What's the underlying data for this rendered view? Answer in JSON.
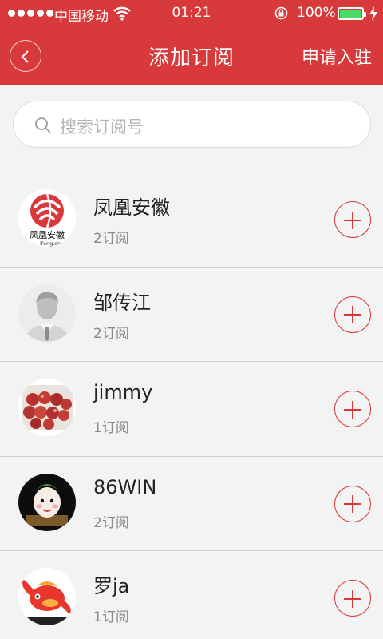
{
  "status_bar": {
    "carrier": "中国移动",
    "time": "01:21",
    "battery": "100%"
  },
  "nav": {
    "title": "添加订阅",
    "apply_label": "申请入驻"
  },
  "search": {
    "placeholder": "搜索订阅号"
  },
  "subscriptions": [
    {
      "name": "凤凰安徽",
      "count": "2订阅",
      "avatar_text": "凤凰安徽",
      "avatar_subtext": "ifeng.cn"
    },
    {
      "name": "邹传江",
      "count": "2订阅"
    },
    {
      "name": "jimmy",
      "count": "1订阅"
    },
    {
      "name": "86WIN",
      "count": "2订阅"
    },
    {
      "name": "罗ja",
      "count": "1订阅"
    }
  ],
  "colors": {
    "brand": "#d8393a",
    "background": "#f3f3f3",
    "battery": "#4cd964"
  }
}
